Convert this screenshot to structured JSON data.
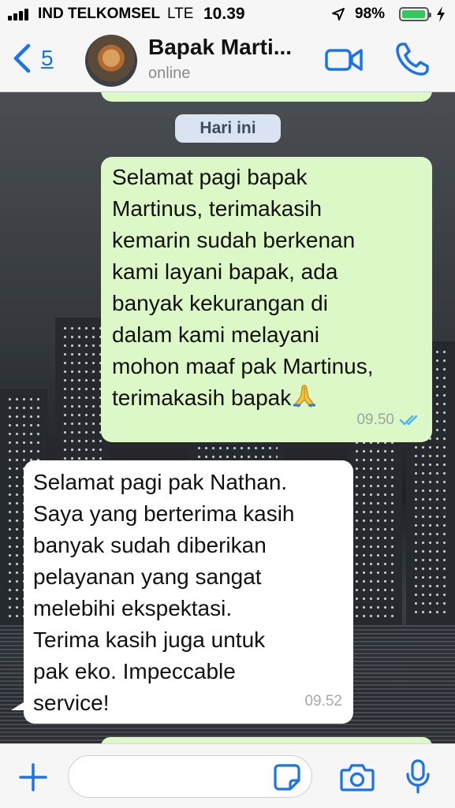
{
  "status_bar": {
    "carrier": "IND TELKOMSEL",
    "network": "LTE",
    "time": "10.39",
    "battery_percent": "98%",
    "battery_level": 0.98
  },
  "header": {
    "back_count": "5",
    "contact_name": "Bapak Marti...",
    "contact_status": "online"
  },
  "chat": {
    "date_chip": "Hari ini",
    "messages": [
      {
        "direction": "outgoing",
        "text": "Selamat pagi bapak\nMartinus, terimakasih\nkemarin sudah berkenan\nkami layani bapak, ada\nbanyak kekurangan di\ndalam kami melayani\nmohon maaf pak Martinus,\nterimakasih bapak",
        "time": "09.50",
        "status": "read"
      },
      {
        "direction": "incoming",
        "text": "Selamat pagi pak Nathan.\nSaya yang berterima kasih\nbanyak sudah diberikan\npelayanan yang sangat\nmelebihi ekspektasi.\nTerima kasih juga untuk\npak eko. Impeccable\nservice!",
        "time": "09.52"
      }
    ]
  },
  "input_bar": {
    "placeholder": ""
  },
  "colors": {
    "accent": "#1a73e8",
    "outgoing_bubble": "#dcf8c6",
    "incoming_bubble": "#ffffff",
    "read_ticks": "#4fb3f6"
  }
}
